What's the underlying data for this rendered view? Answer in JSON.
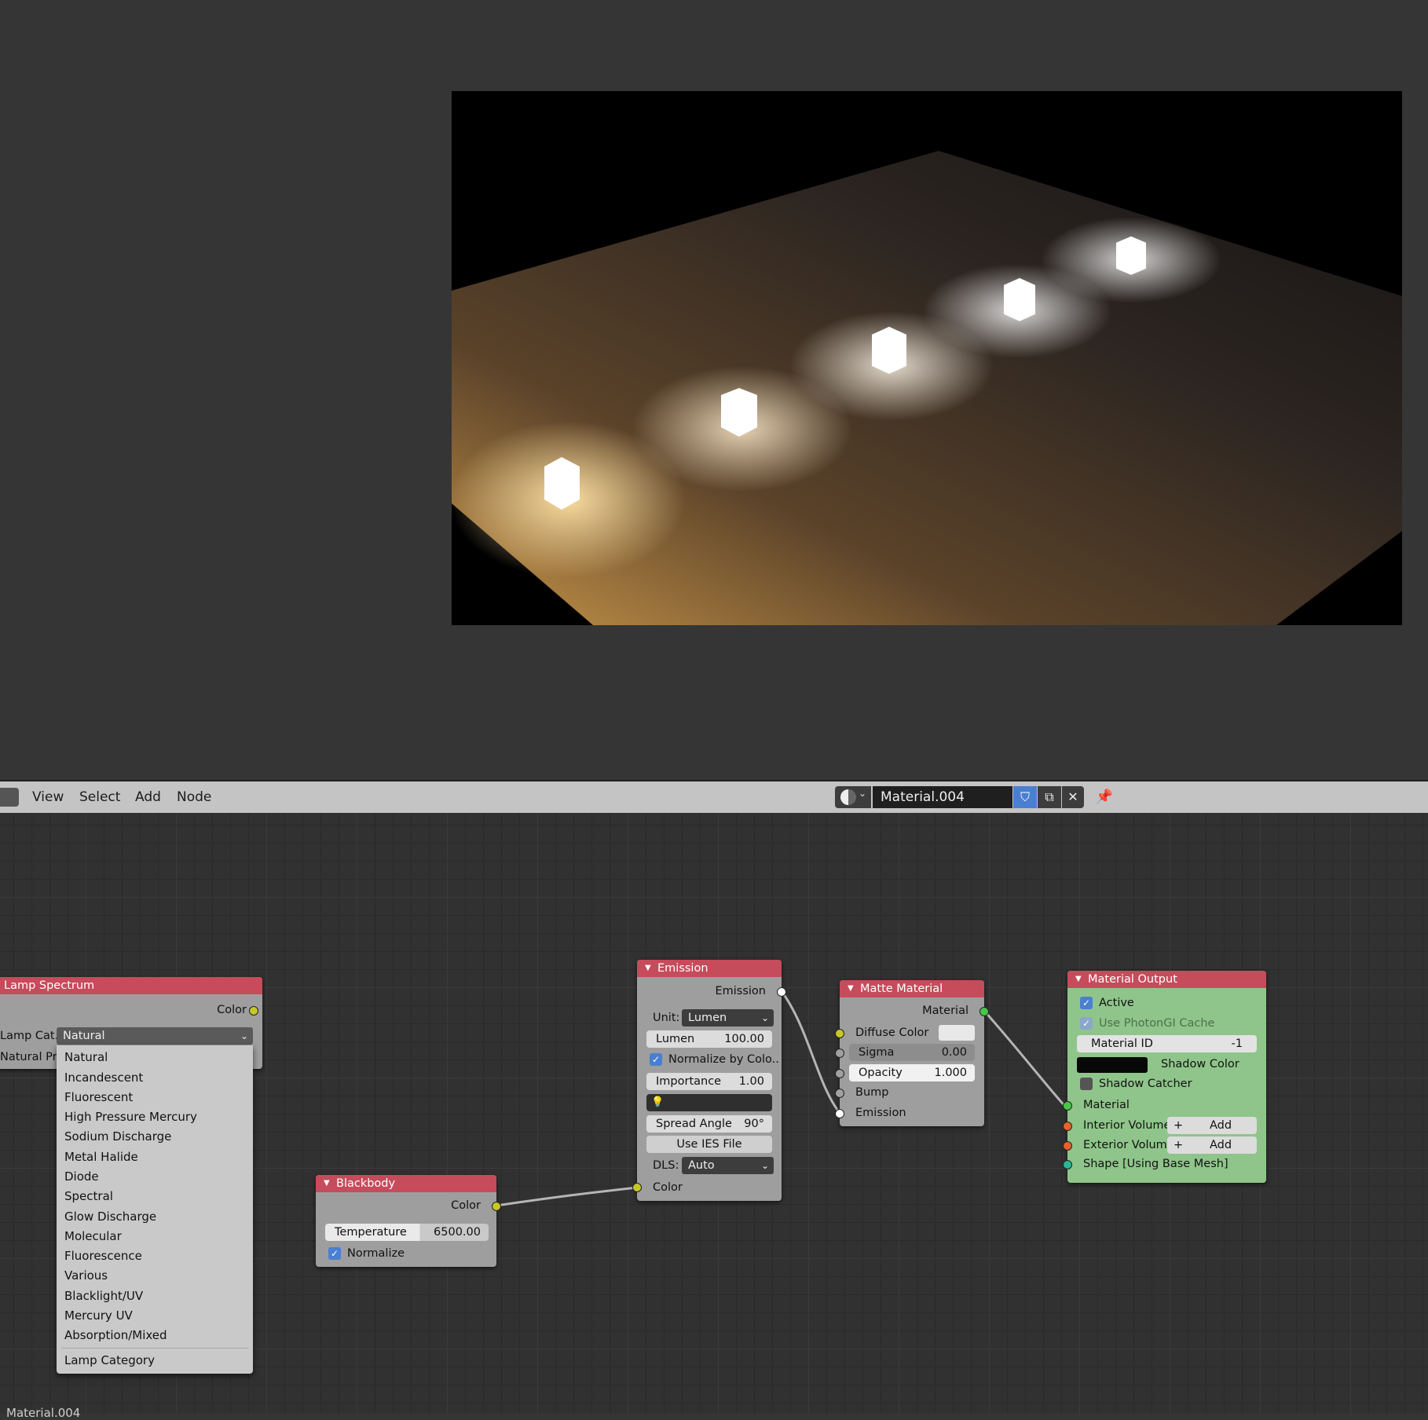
{
  "header": {
    "menus": [
      "View",
      "Select",
      "Add",
      "Node"
    ],
    "material_name": "Material.004"
  },
  "status_text": "Material.004",
  "nodes": {
    "lamp_spectrum": {
      "title": "Lamp Spectrum",
      "output": "Color",
      "lamp_category_label": "Lamp Cat..",
      "lamp_category_value": "Natural",
      "preset_label": "Natural Pr.."
    },
    "lamp_menu": {
      "items": [
        "Natural",
        "Incandescent",
        "Fluorescent",
        "High Pressure Mercury",
        "Sodium Discharge",
        "Metal Halide",
        "Diode",
        "Spectral",
        "Glow Discharge",
        "Molecular",
        "Fluorescence",
        "Various",
        "Blacklight/UV",
        "Mercury UV",
        "Absorption/Mixed"
      ],
      "footer": "Lamp Category"
    },
    "blackbody": {
      "title": "Blackbody",
      "output": "Color",
      "temperature_label": "Temperature",
      "temperature_value": "6500.00",
      "normalize_label": "Normalize"
    },
    "emission": {
      "title": "Emission",
      "output": "Emission",
      "unit_label": "Unit:",
      "unit_value": "Lumen",
      "lumen_label": "Lumen",
      "lumen_value": "100.00",
      "normalize_label": "Normalize by Colo..",
      "importance_label": "Importance",
      "importance_value": "1.00",
      "spread_label": "Spread Angle",
      "spread_value": "90°",
      "ies_label": "Use IES File",
      "dls_label": "DLS:",
      "dls_value": "Auto",
      "input_color": "Color"
    },
    "matte": {
      "title": "Matte Material",
      "output": "Material",
      "diffuse_label": "Diffuse Color",
      "sigma_label": "Sigma",
      "sigma_value": "0.00",
      "opacity_label": "Opacity",
      "opacity_value": "1.000",
      "bump_label": "Bump",
      "emission_label": "Emission"
    },
    "output": {
      "title": "Material Output",
      "active_label": "Active",
      "photongi_label": "Use PhotonGI Cache",
      "material_id_label": "Material ID",
      "material_id_value": "-1",
      "shadow_color_label": "Shadow Color",
      "shadow_catcher_label": "Shadow Catcher",
      "material_label": "Material",
      "interior_label": "Interior Volume",
      "exterior_label": "Exterior Volume",
      "add_label": "Add",
      "shape_label": "Shape [Using Base Mesh]"
    }
  },
  "colors": {
    "node_header": "#c64b5b",
    "output_node_bg": "#8fc58a",
    "checkbox_blue": "#4a7fd1"
  }
}
